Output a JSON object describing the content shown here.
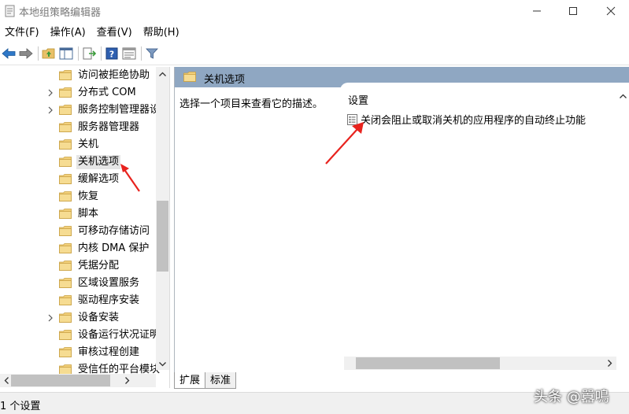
{
  "window": {
    "title": "本地组策略编辑器",
    "icon": "policy-editor-icon",
    "controls": [
      "minimize-icon",
      "maximize-icon",
      "close-icon"
    ]
  },
  "menubar": {
    "items": [
      "文件(F)",
      "操作(A)",
      "查看(V)",
      "帮助(H)"
    ]
  },
  "toolbar": {
    "buttons": [
      "back-arrow-icon",
      "forward-arrow-icon",
      "up-folder-icon",
      "show-hide-tree-icon",
      "export-list-icon",
      "help-icon",
      "properties-pane-icon",
      "filter-icon"
    ]
  },
  "tree": {
    "items": [
      {
        "label": "访问被拒绝协助",
        "expandable": false
      },
      {
        "label": "分布式 COM",
        "expandable": true
      },
      {
        "label": "服务控制管理器设",
        "expandable": true
      },
      {
        "label": "服务器管理器",
        "expandable": false
      },
      {
        "label": "关机",
        "expandable": false
      },
      {
        "label": "关机选项",
        "expandable": false,
        "selected": true
      },
      {
        "label": "缓解选项",
        "expandable": false
      },
      {
        "label": "恢复",
        "expandable": false
      },
      {
        "label": "脚本",
        "expandable": false
      },
      {
        "label": "可移动存储访问",
        "expandable": false
      },
      {
        "label": "内核 DMA 保护",
        "expandable": false
      },
      {
        "label": "凭据分配",
        "expandable": false
      },
      {
        "label": "区域设置服务",
        "expandable": false
      },
      {
        "label": "驱动程序安装",
        "expandable": false
      },
      {
        "label": "设备安装",
        "expandable": true
      },
      {
        "label": "设备运行状况证明",
        "expandable": false
      },
      {
        "label": "审核过程创建",
        "expandable": false
      },
      {
        "label": "受信任的平台模块",
        "expandable": false
      }
    ]
  },
  "details": {
    "header": "关机选项",
    "description": "选择一个项目来查看它的描述。",
    "column_header": "设置",
    "settings": [
      "关闭会阻止或取消关机的应用程序的自动终止功能"
    ]
  },
  "tabs": [
    "扩展",
    "标准"
  ],
  "status": {
    "text": "1 个设置"
  },
  "watermark": "头条 @囂鳴",
  "colors": {
    "header_bg": "#8fa7c2",
    "folder": "#e8c068",
    "annotation_arrow": "#e8231e"
  }
}
